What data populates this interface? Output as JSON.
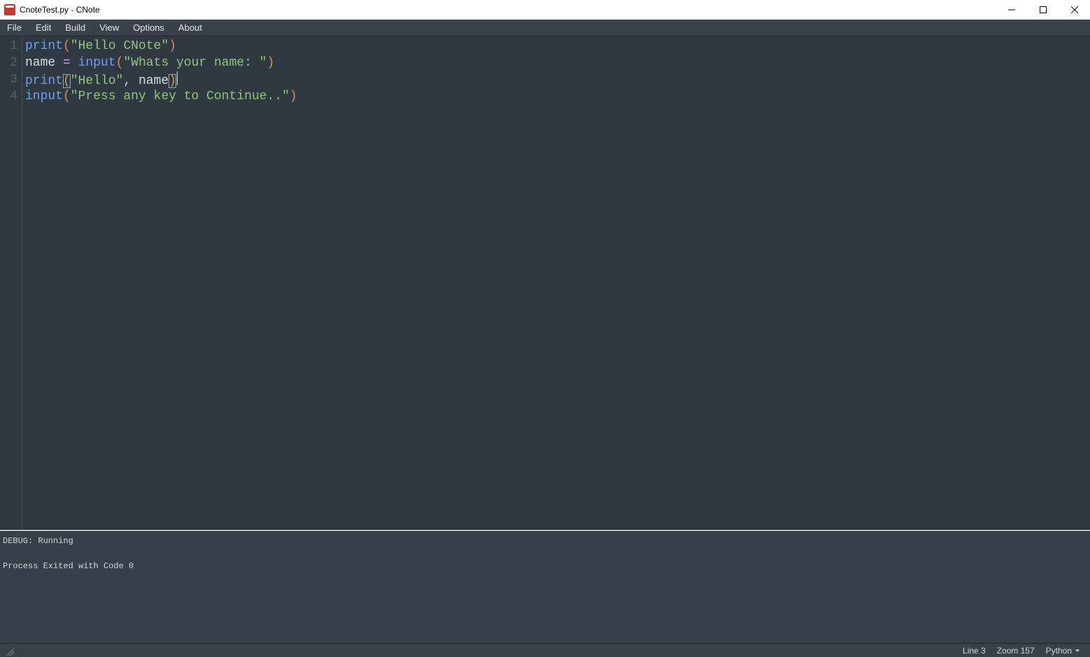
{
  "window": {
    "title": "CnoteTest.py - CNote"
  },
  "menu": {
    "items": [
      "File",
      "Edit",
      "Build",
      "View",
      "Options",
      "About"
    ]
  },
  "editor": {
    "lines": [
      [
        {
          "t": "fn",
          "v": "print"
        },
        {
          "t": "paren",
          "v": "("
        },
        {
          "t": "str",
          "v": "\"Hello CNote\""
        },
        {
          "t": "paren",
          "v": ")"
        }
      ],
      [
        {
          "t": "name",
          "v": "name"
        },
        {
          "t": "name",
          "v": " "
        },
        {
          "t": "op",
          "v": "="
        },
        {
          "t": "name",
          "v": " "
        },
        {
          "t": "fn",
          "v": "input"
        },
        {
          "t": "paren",
          "v": "("
        },
        {
          "t": "str",
          "v": "\"Whats your name: \""
        },
        {
          "t": "paren",
          "v": ")"
        }
      ],
      [
        {
          "t": "fn",
          "v": "print"
        },
        {
          "t": "paren",
          "v": "(",
          "hl": true
        },
        {
          "t": "str",
          "v": "\"Hello\""
        },
        {
          "t": "punct",
          "v": ","
        },
        {
          "t": "name",
          "v": " name"
        },
        {
          "t": "paren",
          "v": ")",
          "hl": true
        },
        {
          "t": "caret",
          "v": ""
        }
      ],
      [
        {
          "t": "fn",
          "v": "input"
        },
        {
          "t": "paren",
          "v": "("
        },
        {
          "t": "str",
          "v": "\"Press any key to Continue..\""
        },
        {
          "t": "paren",
          "v": ")"
        }
      ]
    ],
    "line_numbers": [
      "1",
      "2",
      "3",
      "4"
    ]
  },
  "output": {
    "lines": [
      "DEBUG: Running",
      "",
      "Process Exited with Code 0"
    ]
  },
  "status": {
    "line_label": "Line 3",
    "zoom_label": "Zoom 157",
    "language": "Python"
  }
}
